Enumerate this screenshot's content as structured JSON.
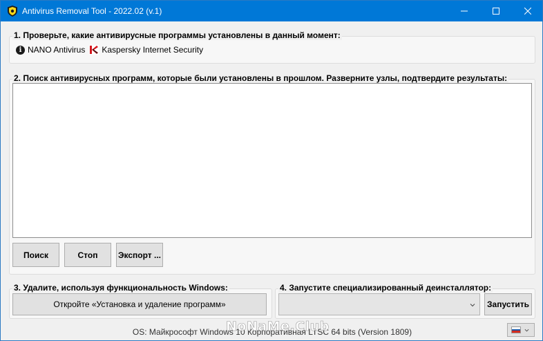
{
  "window": {
    "title": "Antivirus Removal Tool - 2022.02 (v.1)",
    "controls": {
      "minimize_icon": "minimize-icon",
      "maximize_icon": "maximize-icon",
      "close_icon": "close-icon"
    },
    "accent_color": "#0078d7"
  },
  "section1": {
    "label": "1. Проверьте, какие антивирусные программы установлены в данный момент:",
    "installed": [
      {
        "name": "NANO Antivirus",
        "icon": "info-icon"
      },
      {
        "name": "Kaspersky Internet Security",
        "icon": "kaspersky-icon"
      }
    ]
  },
  "section2": {
    "label": "2. Поиск антивирусных программ, которые были установлены в прошлом. Разверните узлы, подтвердите результаты:",
    "buttons": {
      "search": "Поиск",
      "stop": "Стоп",
      "export": "Экспорт ..."
    }
  },
  "section3": {
    "label": "3. Удалите, используя функциональность Windows:",
    "button": "Откройте «Установка и удаление программ»"
  },
  "section4": {
    "label": "4. Запустите специализированный деинсталлятор:",
    "combo_value": "",
    "run_button": "Запустить"
  },
  "status": {
    "os_text": "OS: Майкрософт Windows 10 Корпоративная LTSC 64 bits (Version 1809)",
    "watermark": "NoNaMe.Club",
    "language_flag": "flag-ru-icon"
  }
}
